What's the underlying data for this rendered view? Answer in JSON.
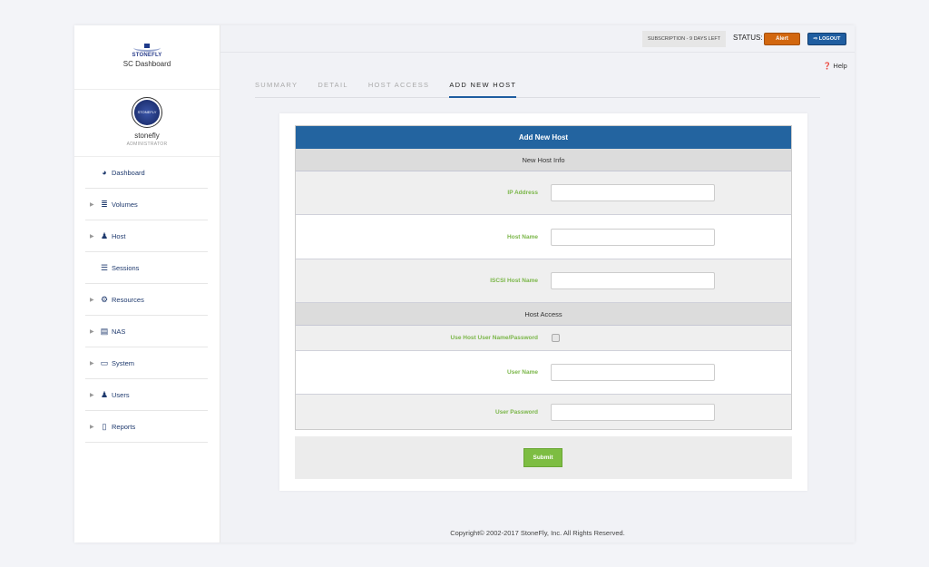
{
  "brand": {
    "logo": "STONEFLY",
    "title": "SC Dashboard"
  },
  "user": {
    "avatar_text": "STONEFLY",
    "name": "stonefly",
    "role": "ADMINISTRATOR"
  },
  "nav": [
    {
      "label": "Dashboard",
      "icon": "dashboard-icon",
      "glyph": "◕",
      "arrow": false
    },
    {
      "label": "Volumes",
      "icon": "database-icon",
      "glyph": "≣",
      "arrow": true
    },
    {
      "label": "Host",
      "icon": "user-icon",
      "glyph": "♟",
      "arrow": true
    },
    {
      "label": "Sessions",
      "icon": "list-icon",
      "glyph": "☰",
      "arrow": false
    },
    {
      "label": "Resources",
      "icon": "gear-icon",
      "glyph": "⚙",
      "arrow": true
    },
    {
      "label": "NAS",
      "icon": "server-icon",
      "glyph": "▤",
      "arrow": true
    },
    {
      "label": "System",
      "icon": "monitor-icon",
      "glyph": "▭",
      "arrow": true
    },
    {
      "label": "Users",
      "icon": "users-icon",
      "glyph": "♟",
      "arrow": true
    },
    {
      "label": "Reports",
      "icon": "file-icon",
      "glyph": "▯",
      "arrow": true
    }
  ],
  "header": {
    "subscription": "SUBSCRIPTION - 9 DAYS LEFT",
    "status_label": "STATUS:",
    "status": "Alert",
    "logout": "⇨ LOGOUT",
    "help": "❓ Help"
  },
  "tabs": [
    {
      "label": "SUMMARY"
    },
    {
      "label": "DETAIL"
    },
    {
      "label": "HOST ACCESS"
    },
    {
      "label": "ADD NEW HOST"
    }
  ],
  "form": {
    "title": "Add New Host",
    "section1": "New Host Info",
    "ip_label": "IP Address",
    "ip_value": "",
    "hostname_label": "Host Name",
    "hostname_value": "",
    "iscsi_label": "ISCSI Host Name",
    "iscsi_value": "",
    "section2": "Host Access",
    "use_creds_label": "Use Host User Name/Password",
    "username_label": "User Name",
    "username_value": "",
    "password_label": "User Password",
    "password_value": "",
    "submit": "Submit"
  },
  "footer": "Copyright© 2002-2017 StoneFly, Inc. All Rights Reserved.",
  "colors": {
    "primary": "#2364a0",
    "accent": "#7dbd42",
    "alert": "#d2670f"
  }
}
